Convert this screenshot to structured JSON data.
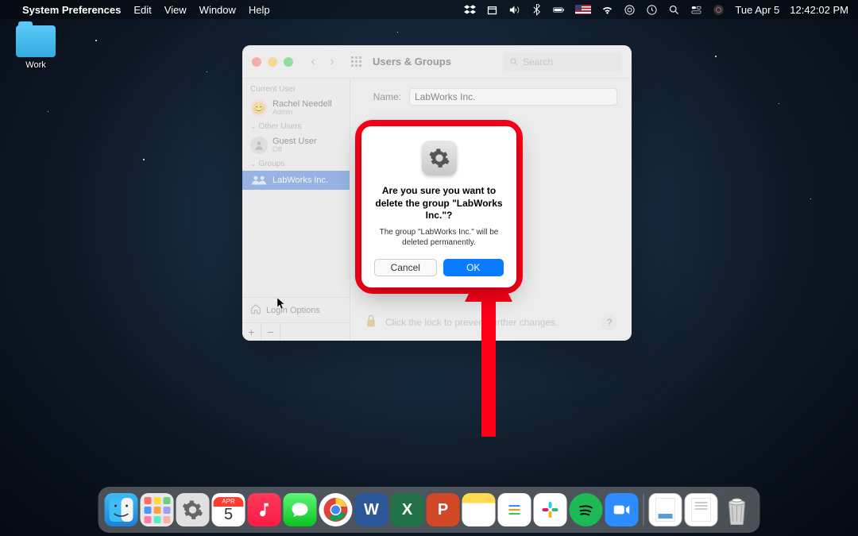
{
  "menubar": {
    "app": "System Preferences",
    "items": [
      "Edit",
      "View",
      "Window",
      "Help"
    ],
    "date": "Tue Apr 5",
    "time": "12:42:02 PM"
  },
  "desktop": {
    "folder_label": "Work"
  },
  "window": {
    "title": "Users & Groups",
    "search_placeholder": "Search",
    "sidebar": {
      "current_user_header": "Current User",
      "current_user_name": "Rachel Needell",
      "current_user_role": "Admin",
      "other_users_header": "Other Users",
      "other_user_name": "Guest User",
      "other_user_status": "Off",
      "groups_header": "Groups",
      "group_name": "LabWorks Inc.",
      "login_options": "Login Options"
    },
    "content": {
      "name_label": "Name:",
      "name_value": "LabWorks Inc."
    },
    "lock_text": "Click the lock to prevent further changes."
  },
  "dialog": {
    "title": "Are you sure you want to delete the group \"LabWorks Inc.\"?",
    "message": "The group \"LabWorks Inc.\" will be deleted permanently.",
    "cancel": "Cancel",
    "ok": "OK"
  },
  "dock": {
    "cal_month": "APR",
    "cal_day": "5"
  }
}
